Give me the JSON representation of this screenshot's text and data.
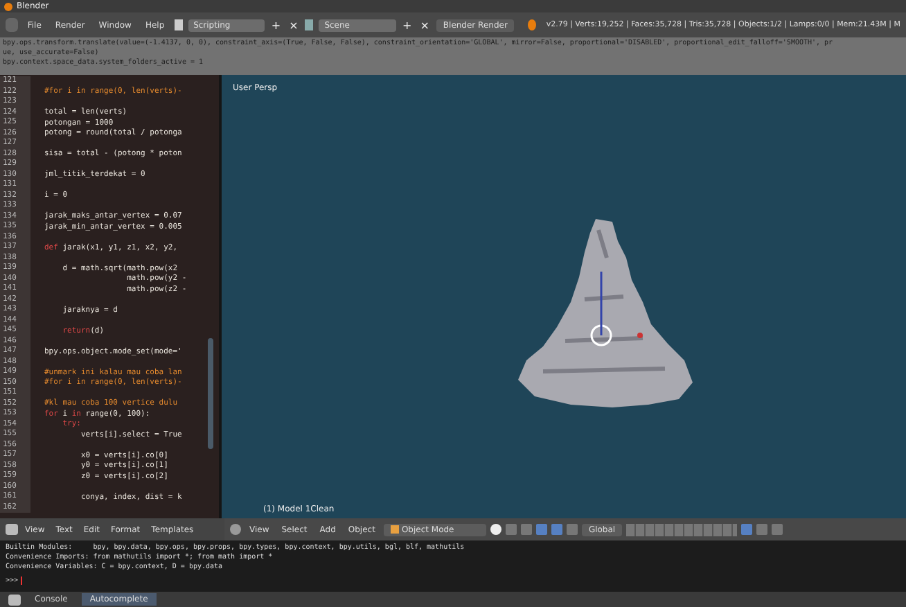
{
  "window": {
    "title": "Blender"
  },
  "menu": [
    "File",
    "Render",
    "Window",
    "Help"
  ],
  "layout_field": "Scripting",
  "scene_field": "Scene",
  "add_button": "+",
  "close_button": "×",
  "engine": "Blender Render",
  "stats": "v2.79 | Verts:19,252 | Faces:35,728 | Tris:35,728 | Objects:1/2 | Lamps:0/0 | Mem:21.43M | M",
  "info_log": [
    "bpy.ops.transform.translate(value=(-1.4137, 0, 0), constraint_axis=(True, False, False), constraint_orientation='GLOBAL', mirror=False, proportional='DISABLED', proportional_edit_falloff='SMOOTH', pr",
    "ue, use_accurate=False)",
    "bpy.context.space_data.system_folders_active = 1"
  ],
  "code_lines": [
    {
      "number": "121"
    },
    {
      "number": "122",
      "parts": [
        {
          "text": "#for i in range(0, len(verts)-",
          "kind": "comment"
        }
      ]
    },
    {
      "number": "123"
    },
    {
      "number": "124",
      "parts": [
        {
          "text": "total = len(verts)",
          "kind": "plain"
        }
      ]
    },
    {
      "number": "125",
      "parts": [
        {
          "text": "potongan = 1000",
          "kind": "plain"
        }
      ]
    },
    {
      "number": "126",
      "parts": [
        {
          "text": "potong = round(total / potonga",
          "kind": "plain"
        }
      ]
    },
    {
      "number": "127"
    },
    {
      "number": "128",
      "parts": [
        {
          "text": "sisa = total - (potong * poton",
          "kind": "plain"
        }
      ]
    },
    {
      "number": "129"
    },
    {
      "number": "130",
      "parts": [
        {
          "text": "jml_titik_terdekat = 0",
          "kind": "plain"
        }
      ]
    },
    {
      "number": "131"
    },
    {
      "number": "132",
      "parts": [
        {
          "text": "i = 0",
          "kind": "plain"
        }
      ]
    },
    {
      "number": "133"
    },
    {
      "number": "134",
      "parts": [
        {
          "text": "jarak_maks_antar_vertex = 0.07",
          "kind": "plain"
        }
      ]
    },
    {
      "number": "135",
      "parts": [
        {
          "text": "jarak_min_antar_vertex = 0.005",
          "kind": "plain"
        }
      ]
    },
    {
      "number": "136"
    },
    {
      "number": "137",
      "parts": [
        {
          "text": "def",
          "kind": "keyword"
        },
        {
          "text": " jarak(x1, y1, z1, x2, y2,",
          "kind": "plain"
        }
      ]
    },
    {
      "number": "138"
    },
    {
      "number": "139",
      "parts": [
        {
          "text": "    d = math.sqrt(math.pow(x2",
          "kind": "plain"
        }
      ]
    },
    {
      "number": "140",
      "parts": [
        {
          "text": "                  math.pow(y2 -",
          "kind": "plain"
        }
      ]
    },
    {
      "number": "141",
      "parts": [
        {
          "text": "                  math.pow(z2 -",
          "kind": "plain"
        }
      ]
    },
    {
      "number": "142"
    },
    {
      "number": "143",
      "parts": [
        {
          "text": "    jaraknya = d",
          "kind": "plain"
        }
      ]
    },
    {
      "number": "144"
    },
    {
      "number": "145",
      "parts": [
        {
          "text": "    return",
          "kind": "keyword"
        },
        {
          "text": "(d)",
          "kind": "plain"
        }
      ]
    },
    {
      "number": "146"
    },
    {
      "number": "147",
      "parts": [
        {
          "text": "bpy.ops.object.mode_set(mode='",
          "kind": "plain"
        }
      ]
    },
    {
      "number": "148"
    },
    {
      "number": "149",
      "parts": [
        {
          "text": "#unmark ini kalau mau coba lan",
          "kind": "comment"
        }
      ]
    },
    {
      "number": "150",
      "parts": [
        {
          "text": "#for i in range(0, len(verts)-",
          "kind": "comment"
        }
      ]
    },
    {
      "number": "151"
    },
    {
      "number": "152",
      "parts": [
        {
          "text": "#kl mau coba 100 vertice dulu",
          "kind": "comment"
        }
      ]
    },
    {
      "number": "153",
      "parts": [
        {
          "text": "for",
          "kind": "keyword"
        },
        {
          "text": " i ",
          "kind": "plain"
        },
        {
          "text": "in",
          "kind": "keyword"
        },
        {
          "text": " range(0, 100):",
          "kind": "plain"
        }
      ]
    },
    {
      "number": "154",
      "parts": [
        {
          "text": "    try:",
          "kind": "keyword"
        }
      ]
    },
    {
      "number": "155",
      "parts": [
        {
          "text": "        verts[i].select = True",
          "kind": "plain"
        }
      ]
    },
    {
      "number": "156"
    },
    {
      "number": "157",
      "parts": [
        {
          "text": "        x0 = verts[i].co[0]",
          "kind": "plain"
        }
      ]
    },
    {
      "number": "158",
      "parts": [
        {
          "text": "        y0 = verts[i].co[1]",
          "kind": "plain"
        }
      ]
    },
    {
      "number": "159",
      "parts": [
        {
          "text": "        z0 = verts[i].co[2]",
          "kind": "plain"
        }
      ]
    },
    {
      "number": "160"
    },
    {
      "number": "161",
      "parts": [
        {
          "text": "        conya, index, dist = k",
          "kind": "plain"
        }
      ]
    },
    {
      "number": "162"
    }
  ],
  "viewport": {
    "view_label": "User Persp",
    "object_label": "(1) Model 1Clean"
  },
  "editor_menu": [
    "View",
    "Text",
    "Edit",
    "Format",
    "Templates"
  ],
  "viewport_menu": [
    "View",
    "Select",
    "Add",
    "Object"
  ],
  "mode": "Object Mode",
  "orientation": "Global",
  "console_lines": [
    "Builtin Modules:     bpy, bpy.data, bpy.ops, bpy.props, bpy.types, bpy.context, bpy.utils, bgl, blf, mathutils",
    "Convenience Imports: from mathutils import *; from math import *",
    "Convenience Variables: C = bpy.context, D = bpy.data"
  ],
  "prompt": ">>>",
  "console_tabs": [
    {
      "label": "Console",
      "selected": false
    },
    {
      "label": "Autocomplete",
      "selected": true
    }
  ]
}
